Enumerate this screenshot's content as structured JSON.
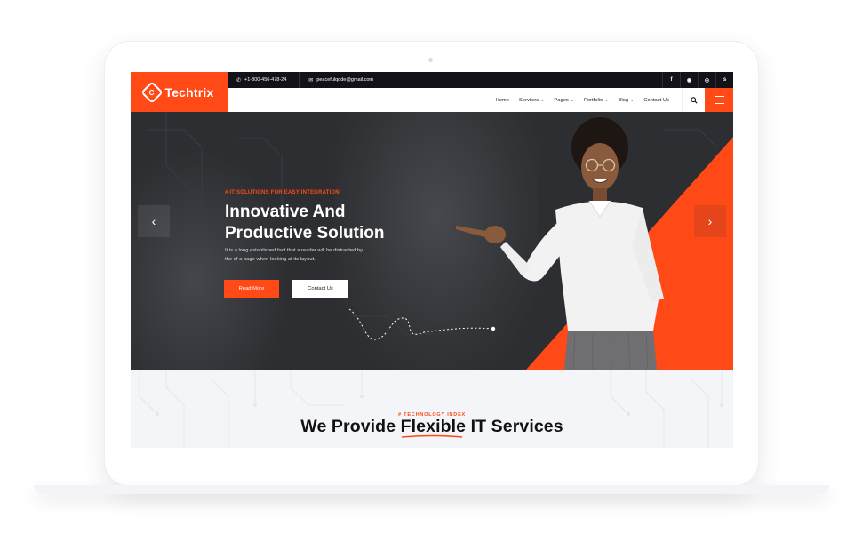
{
  "brand": {
    "name": "Techtrix",
    "accent": "#ff4a17",
    "dark": "#2d2e32"
  },
  "topbar": {
    "phone": "+1-800-456-478-24",
    "email": "peacefulqode@gmail.com",
    "socials": [
      {
        "icon": "facebook-icon",
        "glyph": "f"
      },
      {
        "icon": "github-icon",
        "glyph": "◉"
      },
      {
        "icon": "instagram-icon",
        "glyph": "◎"
      },
      {
        "icon": "skype-icon",
        "glyph": "s"
      }
    ]
  },
  "nav": {
    "items": [
      {
        "label": "Home",
        "dropdown": false
      },
      {
        "label": "Services",
        "dropdown": true
      },
      {
        "label": "Pages",
        "dropdown": true
      },
      {
        "label": "Portfolio",
        "dropdown": true
      },
      {
        "label": "Blog",
        "dropdown": true
      },
      {
        "label": "Contact Us",
        "dropdown": false
      }
    ]
  },
  "hero": {
    "eyebrow": "# IT SOLUTIONS FOR EASY INTEGRATION",
    "title_line1": "Innovative And",
    "title_line2": "Productive Solution",
    "description_line1": "It is a long established fact that a reader will be distracted by",
    "description_line2": "the of a page when looking at its layout.",
    "primary_button": "Read More",
    "secondary_button": "Contact Us",
    "prev_glyph": "‹",
    "next_glyph": "›"
  },
  "services": {
    "eyebrow": "# TECHNOLOGY INDEX",
    "title_before": "We Provide ",
    "title_highlight": "Flexible",
    "title_after": " IT Services"
  }
}
